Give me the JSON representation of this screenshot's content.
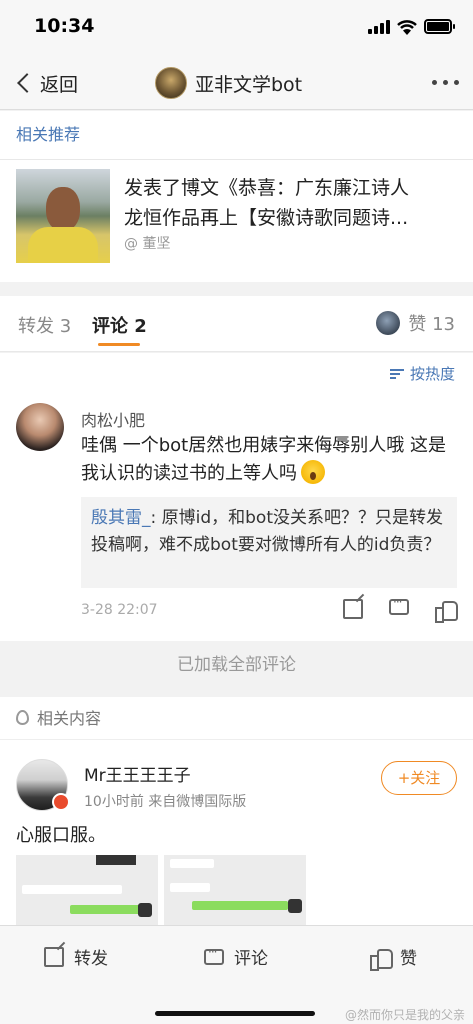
{
  "status": {
    "time": "10:34"
  },
  "nav": {
    "back_label": "返回",
    "title": "亚非文学bot"
  },
  "recommend": {
    "heading": "相关推荐",
    "line1": "发表了博文《恭喜：广东廉江诗人",
    "line2": "龙恒作品再上【安徽诗歌同题诗...",
    "author": "@ 董坚"
  },
  "tabs": {
    "repost": "转发 3",
    "comment": "评论 2",
    "likes": "赞 13"
  },
  "comments": {
    "sort_label": "按热度",
    "item": {
      "name": "肉松小肥",
      "body": "哇偶 一个bot居然也用婊字来侮辱别人哦 这是我认识的读过书的上等人吗",
      "reply_name": "殷其雷_",
      "reply_body": ": 原博id，和bot没关系吧？？只是转发投稿啊，难不成bot要对微博所有人的id负责？",
      "time": "3-28 22:07"
    }
  },
  "loaded_label": "已加载全部评论",
  "related": {
    "heading": "相关内容",
    "post": {
      "name": "Mr王王王王子",
      "meta": "10小时前  来自微博国际版",
      "follow": "+关注",
      "text": "心服口服。"
    }
  },
  "bottom": {
    "repost": "转发",
    "comment": "评论",
    "like": "赞",
    "watermark": "@然而你只是我的父亲"
  }
}
